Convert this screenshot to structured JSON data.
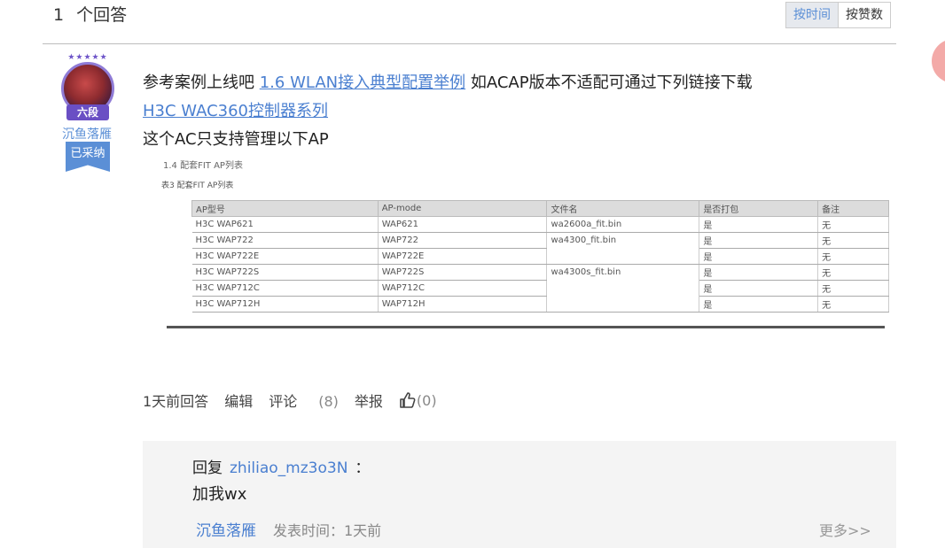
{
  "header": {
    "count": "1",
    "label": "个回答"
  },
  "sort": {
    "by_time": "按时间",
    "by_likes": "按赞数"
  },
  "author": {
    "stars": "★★★★★",
    "rank": "六段",
    "name": "沉鱼落雁",
    "accepted": "已采纳"
  },
  "answer": {
    "text_pre": "参考案例上线吧 ",
    "link1": "1.6 WLAN接入典型配置举例",
    "text_mid": " 如ACAP版本不适配可通过下列链接下载",
    "link2": "H3C WAC360控制器系列",
    "line3": "这个AC只支持管理以下AP"
  },
  "screenshot": {
    "heading": "1.4 配套FIT AP列表",
    "caption": "表3 配套FIT AP列表",
    "columns": [
      "AP型号",
      "AP-mode",
      "文件名",
      "是否打包",
      "备注"
    ],
    "rows": [
      [
        "H3C WAP621",
        "WAP621",
        "wa2600a_fit.bin",
        "是",
        "无"
      ],
      [
        "H3C WAP722",
        "WAP722",
        "wa4300_fit.bin",
        "是",
        "无"
      ],
      [
        "H3C WAP722E",
        "WAP722E",
        "",
        "是",
        "无"
      ],
      [
        "H3C WAP722S",
        "WAP722S",
        "wa4300s_fit.bin",
        "是",
        "无"
      ],
      [
        "H3C WAP712C",
        "WAP712C",
        "",
        "是",
        "无"
      ],
      [
        "H3C WAP712H",
        "WAP712H",
        "",
        "是",
        "无"
      ]
    ]
  },
  "actions": {
    "time": "1天前回答",
    "edit": "编辑",
    "comment": "评论",
    "comment_count": "(8)",
    "report": "举报",
    "like_count": "(0)"
  },
  "reply": {
    "prefix": "回复",
    "target": "zhiliao_mz3o3N",
    "colon": "：",
    "text": "加我wx",
    "user": "沉鱼落雁",
    "time": "发表时间：1天前",
    "more": "更多>>"
  }
}
